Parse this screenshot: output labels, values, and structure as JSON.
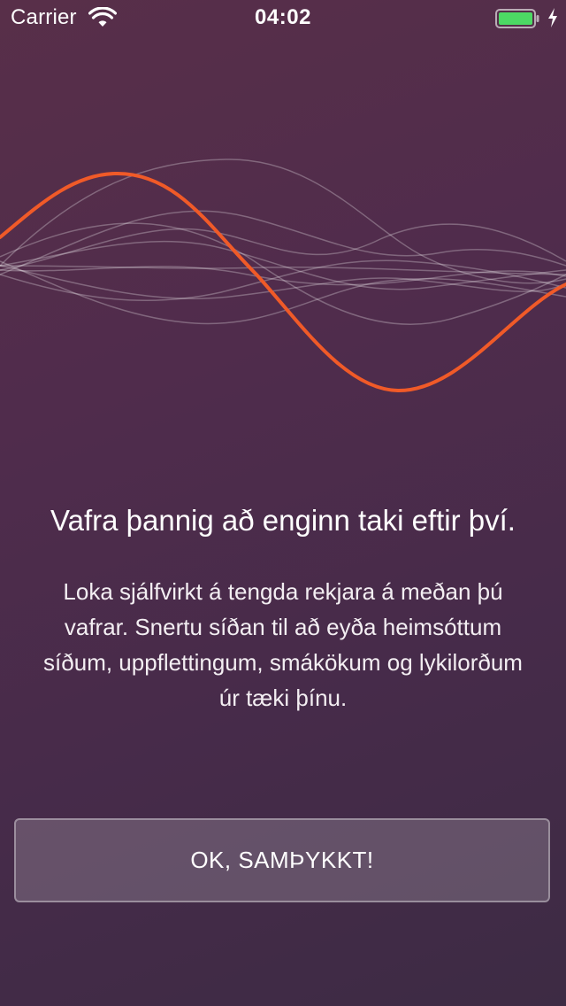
{
  "status_bar": {
    "carrier": "Carrier",
    "time": "04:02",
    "battery_color": "#4cd964"
  },
  "onboarding": {
    "headline": "Vafra þannig að enginn taki eftir því.",
    "body": "Loka sjálfvirkt á tengda rekjara á meðan þú vafrar. Snertu síðan til að eyða heimsóttum síðum, uppflettingum, smákökum og lykilorðum úr tæki þínu.",
    "accept_button_label": "OK, SAMÞYKKT!"
  },
  "colors": {
    "accent_wave": "#f05a28",
    "background_top": "#582f49",
    "background_bottom": "#3d2b44"
  }
}
